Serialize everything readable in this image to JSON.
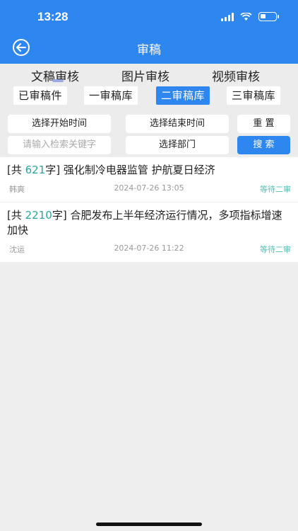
{
  "status_bar": {
    "time": "13:28"
  },
  "header": {
    "title": "审稿"
  },
  "main_tabs": [
    "文稿审核",
    "图片审核",
    "视频审核"
  ],
  "sub_tabs": [
    "已审稿件",
    "一审稿库",
    "二审稿库",
    "三审稿库"
  ],
  "filters": {
    "start_time": "选择开始时间",
    "end_time": "选择结束时间",
    "reset": "重 置",
    "search_placeholder": "请输入检索关键字",
    "department": "选择部门",
    "search": "搜 索"
  },
  "items": [
    {
      "prefix": "[共 ",
      "count": "621",
      "suffix": "字] ",
      "title": "强化制冷电器监管 护航夏日经济",
      "author": "韩爽",
      "date": "2024-07-26 13:05",
      "status": "等待二审"
    },
    {
      "prefix": "[共 ",
      "count": "2210",
      "suffix": "字] ",
      "title": "合肥发布上半年经济运行情况，多项指标增速加快",
      "author": "沈运",
      "date": "2024-07-26 11:22",
      "status": "等待二审"
    }
  ],
  "colors": {
    "brand": "#2e86ef",
    "count": "#2aa79b",
    "status": "#4ec2b4"
  },
  "battery_level": 0.35
}
